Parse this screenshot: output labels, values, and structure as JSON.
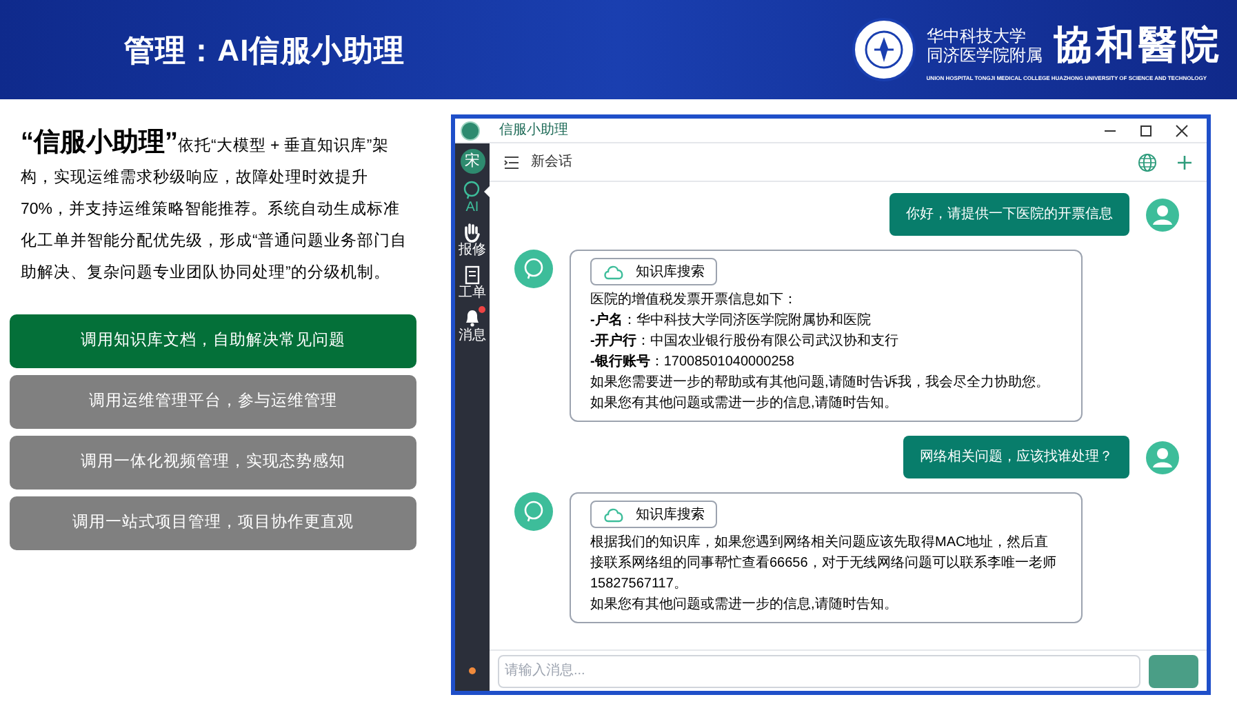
{
  "slide": {
    "title": "管理：AI信服小助理",
    "logo": {
      "line_1": "华中科技大学",
      "line_2": "同济医学院附属",
      "calligraphy": "協和醫院",
      "english": "UNION HOSPITAL TONGJI MEDICAL COLLEGE HUAZHONG UNIVERSITY OF SCIENCE AND TECHNOLOGY"
    }
  },
  "intro": {
    "heading": "“信服小助理”",
    "text": "依托“大模型 + 垂直知识库”架构，实现运维需求秒级响应，故障处理时效提升 70%，并支持运维策略智能推荐。系统自动生成标准化工单并智能分配优先级，形成“普通问题业务部门自助解决、复杂问题专业团队协同处理”的分级机制。"
  },
  "options": [
    {
      "label": "调用知识库文档，自助解决常见问题",
      "selected": true
    },
    {
      "label": "调用运维管理平台，参与运维管理",
      "selected": false
    },
    {
      "label": "调用一体化视频管理，实现态势感知",
      "selected": false
    },
    {
      "label": "调用一站式项目管理，项目协作更直观",
      "selected": false
    }
  ],
  "app": {
    "window_title": "信服小助理",
    "user_initial": "宋",
    "nav": [
      {
        "label": "AI",
        "kind": "ai",
        "selected": true,
        "badge": false
      },
      {
        "label": "报修",
        "kind": "hand",
        "selected": false,
        "badge": false
      },
      {
        "label": "工单",
        "kind": "order",
        "selected": false,
        "badge": false
      },
      {
        "label": "消息",
        "kind": "bell",
        "selected": false,
        "badge": true
      }
    ],
    "toolbar_title": "新会话",
    "messages": [
      {
        "kind": "user",
        "text": "你好，请提供一下医院的开票信息"
      },
      {
        "kind": "assistant",
        "tool": "知识库搜索",
        "lines": [
          "医院的增值税发票开票信息如下：",
          "**-户名**：华中科技大学同济医学院附属协和医院",
          "**-开户行**：中国农业银行股份有限公司武汉协和支行",
          "**-银行账号**：17008501040000258",
          "如果您需要进一步的帮助或有其他问题,请随时告诉我，我会尽全力协助您。",
          "如果您有其他问题或需进一步的信息,请随时告知。"
        ]
      },
      {
        "kind": "user",
        "text": "网络相关问题，应该找谁处理？"
      },
      {
        "kind": "assistant",
        "tool": "知识库搜索",
        "lines": [
          "根据我们的知识库，如果您遇到网络相关问题应该先取得MAC地址，然后直接联系网络组的同事帮忙查看66656，对于无线网络问题可以联系李唯一老师15827567117。",
          "如果您有其他问题或需进一步的信息,请随时告知。"
        ]
      }
    ],
    "input": {
      "placeholder": "请输入消息..."
    }
  }
}
